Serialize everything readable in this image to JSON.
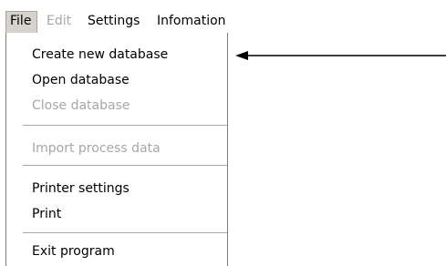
{
  "menubar": {
    "file": "File",
    "edit": "Edit",
    "settings": "Settings",
    "information": "Infomation"
  },
  "file_menu": {
    "create_new_database": "Create new database",
    "open_database": "Open database",
    "close_database": "Close database",
    "import_process_data": "Import process data",
    "printer_settings": "Printer settings",
    "print": "Print",
    "exit_program": "Exit program"
  },
  "colors": {
    "disabled_text": "#a7a7a7",
    "open_menu_background": "#d6d3ce",
    "arrow": "#000000"
  },
  "annotation": {
    "icon": "arrow-left-icon"
  }
}
